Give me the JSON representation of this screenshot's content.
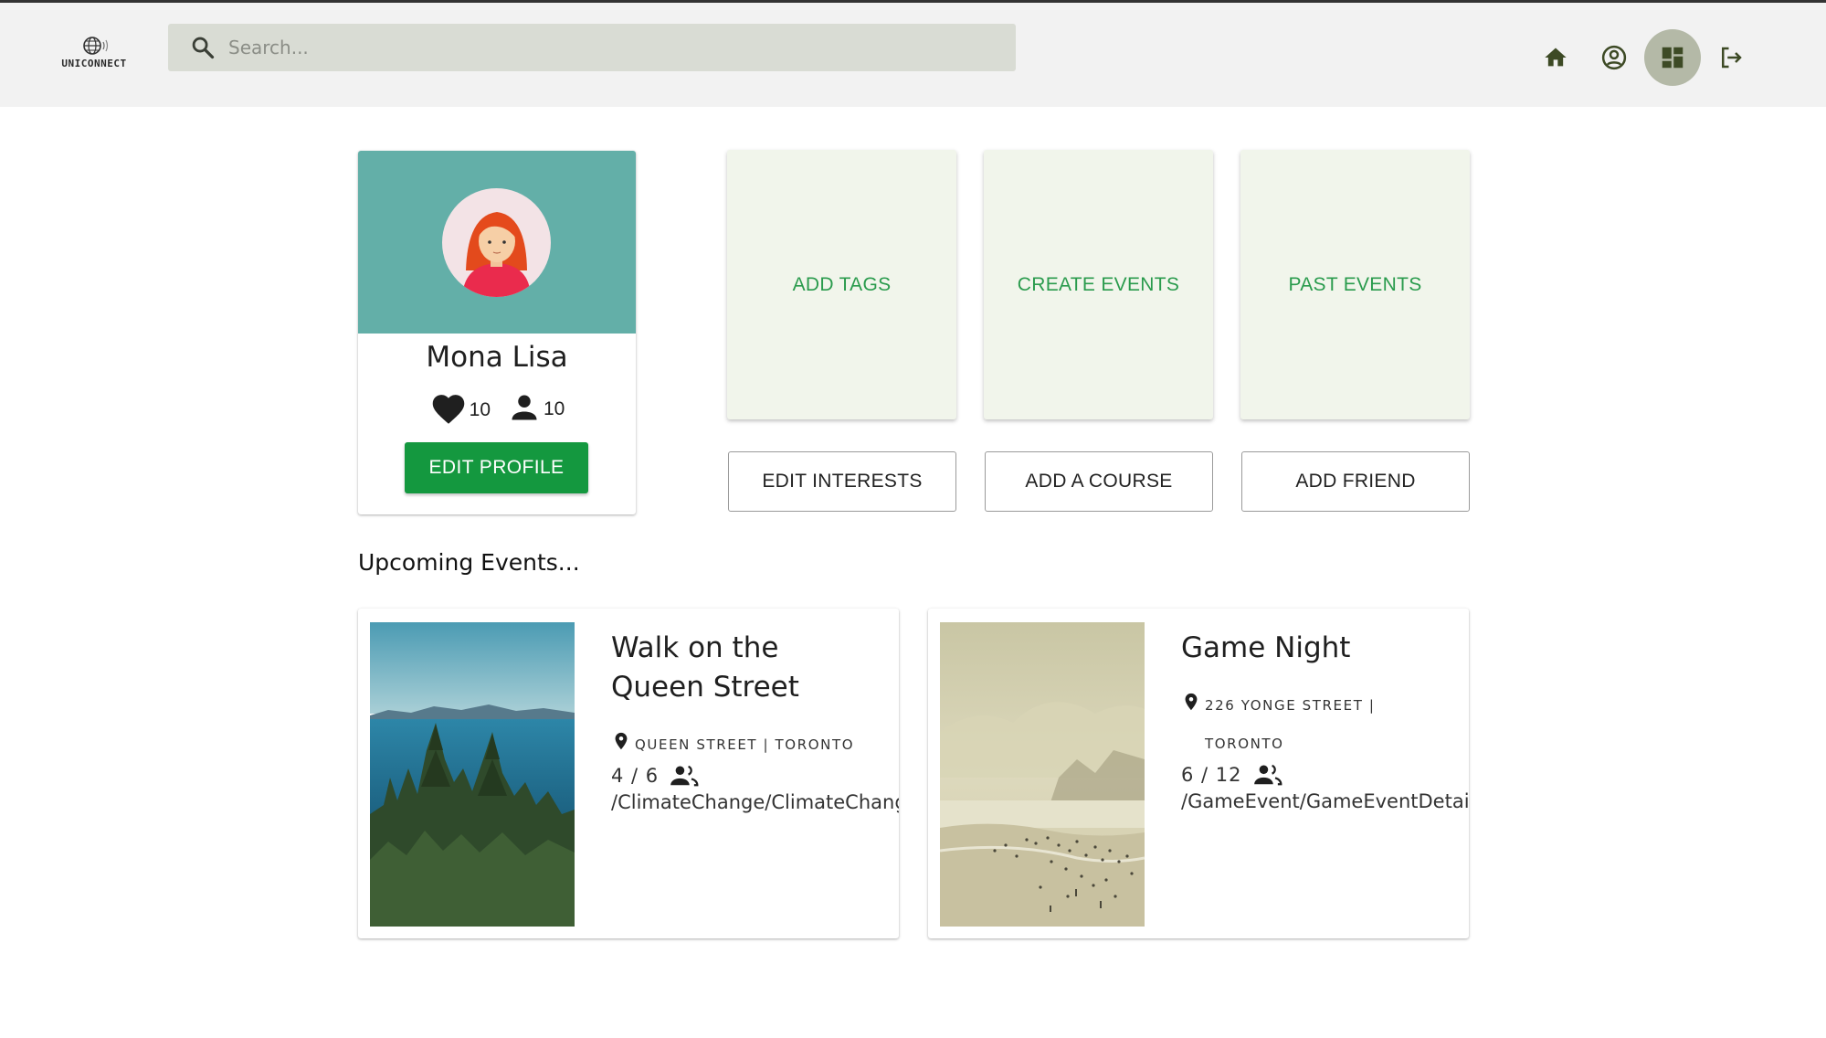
{
  "header": {
    "logo_text": "UNICONNECT",
    "search_placeholder": "Search...",
    "nav": [
      {
        "icon": "home-icon"
      },
      {
        "icon": "account-circle-icon"
      },
      {
        "icon": "dashboard-icon",
        "active": true
      },
      {
        "icon": "logout-icon"
      }
    ]
  },
  "profile": {
    "name": "Mona Lisa",
    "likes": "10",
    "friends": "10",
    "edit_label": "EDIT PROFILE"
  },
  "tiles": [
    "ADD TAGS",
    "CREATE EVENTS",
    "PAST EVENTS"
  ],
  "buttons": [
    "EDIT INTERESTS",
    "ADD A COURSE",
    "ADD FRIEND"
  ],
  "upcoming_title": "Upcoming Events...",
  "events": [
    {
      "title_line1": "Walk on the",
      "title_line2": "Queen Street",
      "location_line1": "QUEEN STREET | TORONTO",
      "location_line2": "",
      "count": "4 / 6",
      "link": "/ClimateChange/ClimateChangeDetail"
    },
    {
      "title_line1": "Game Night",
      "title_line2": "",
      "location_line1": "226 YONGE STREET |",
      "location_line2": "TORONTO",
      "count": "6 / 12",
      "link": "/GameEvent/GameEventDetail"
    }
  ],
  "colors": {
    "accent_green": "#14983f",
    "tile_text": "#2a9b4d",
    "tile_bg": "#f1f5eb",
    "banner": "#63afa8",
    "appbar": "#f2f2f2",
    "search_bg": "#d9dcd4",
    "nav_icon": "#3d4a25"
  }
}
